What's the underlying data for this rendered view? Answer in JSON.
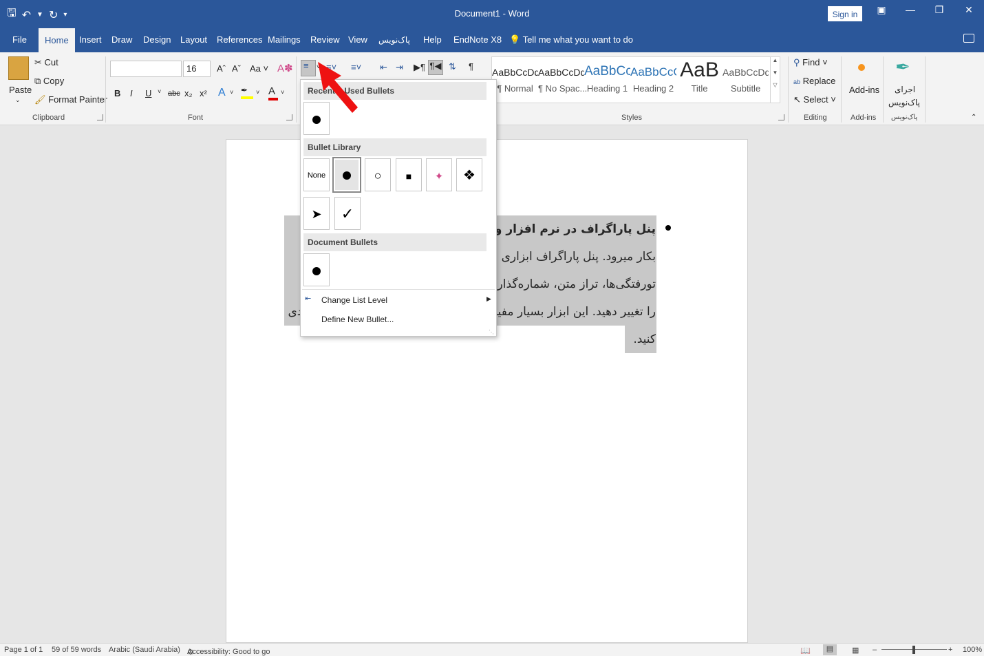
{
  "titlebar": {
    "title": "Document1 - Word",
    "signin": "Sign in"
  },
  "tabs": [
    "File",
    "Home",
    "Insert",
    "Draw",
    "Design",
    "Layout",
    "References",
    "Mailings",
    "Review",
    "View",
    "پاک‌نویس",
    "Help",
    "EndNote X8"
  ],
  "tellme": "Tell me what you want to do",
  "ribbon": {
    "clipboard": {
      "paste": "Paste",
      "cut": "Cut",
      "copy": "Copy",
      "format_painter": "Format Painter",
      "label": "Clipboard"
    },
    "font": {
      "font_name": "",
      "font_size": "16",
      "label": "Font",
      "bold": "B",
      "italic": "I",
      "underline": "U",
      "strike": "abc",
      "sub": "x₂",
      "sup": "x²",
      "aa": "Aa"
    },
    "styles": {
      "label": "Styles",
      "items": [
        {
          "preview": "AaBbCcDd",
          "name": "¶ Normal"
        },
        {
          "preview": "AaBbCcDd",
          "name": "¶ No Spac..."
        },
        {
          "preview": "AaBbCc",
          "name": "Heading 1"
        },
        {
          "preview": "AaBbCcC",
          "name": "Heading 2"
        },
        {
          "preview": "AaB",
          "name": "Title"
        },
        {
          "preview": "AaBbCcDd",
          "name": "Subtitle"
        }
      ]
    },
    "editing": {
      "find": "Find",
      "replace": "Replace",
      "select": "Select",
      "label": "Editing"
    },
    "addins": {
      "button": "Add-ins",
      "label": "Add-ins"
    },
    "paknevis": {
      "button_line1": "اجرای",
      "button_line2": "پاک‌نویس",
      "label": "پاک‌نویس"
    }
  },
  "bullet_menu": {
    "recent_header": "Recently Used Bullets",
    "library_header": "Bullet Library",
    "none_label": "None",
    "document_header": "Document Bullets",
    "change_level": "Change List Level",
    "define_new": "Define New Bullet..."
  },
  "document": {
    "lines": [
      "پنل پاراگراف در نرم افزار ورد Word برای تنظیم پاراگراف‌ها",
      "بکار میرود. پنل پاراگراف ابزاری است که به شما امکان میدهد تا خط،",
      "تورفتگی‌ها، تراز متن، شماره‌گذاری، نقطه‌گذاری و سایر ویژگی‌های متن",
      "را تغییر دهید. این ابزار بسیار مفید است و میتوانید از آن استفاده کنید و بندی",
      "کنید."
    ]
  },
  "status": {
    "page": "Page 1 of 1",
    "words": "59 of 59 words",
    "language": "Arabic (Saudi Arabia)",
    "accessibility": "Accessibility: Good to go",
    "zoom": "100%"
  }
}
